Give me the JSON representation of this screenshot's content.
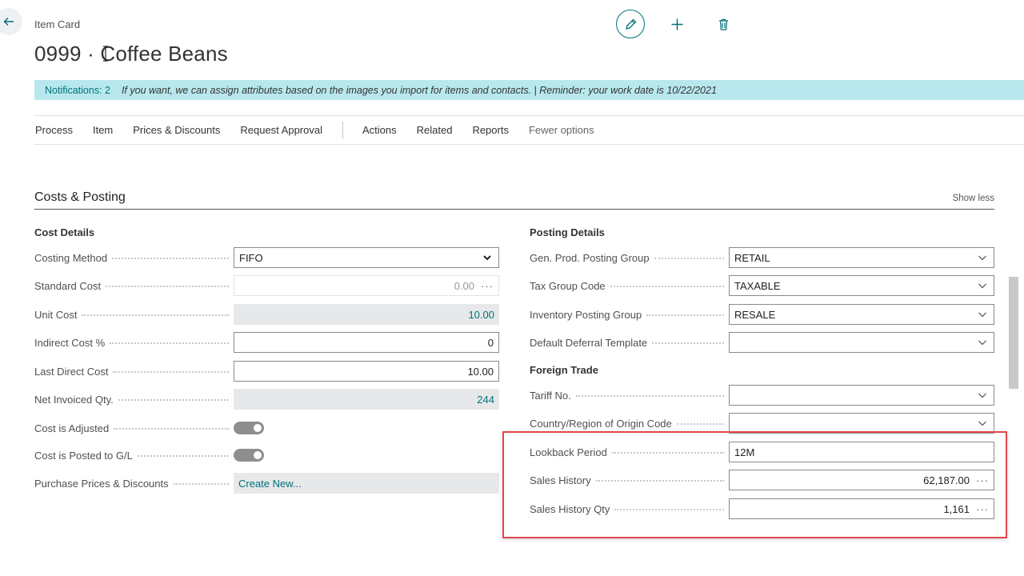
{
  "header": {
    "caption": "Item Card",
    "title": "0999 · Coffee Beans"
  },
  "notification": {
    "count_label": "Notifications: 2",
    "text": "If you want, we can assign attributes based on the images you import for items and contacts. |  Reminder: your work date is 10/22/2021"
  },
  "action_bar": {
    "left": [
      "Process",
      "Item",
      "Prices & Discounts",
      "Request Approval"
    ],
    "right": [
      "Actions",
      "Related",
      "Reports"
    ],
    "fewer_options": "Fewer options"
  },
  "section": {
    "title": "Costs & Posting",
    "show_less": "Show less"
  },
  "cost_details": {
    "title": "Cost Details",
    "costing_method": {
      "label": "Costing Method",
      "value": "FIFO"
    },
    "standard_cost": {
      "label": "Standard Cost",
      "value": "0.00"
    },
    "unit_cost": {
      "label": "Unit Cost",
      "value": "10.00"
    },
    "indirect_cost": {
      "label": "Indirect Cost %",
      "value": "0"
    },
    "last_direct_cost": {
      "label": "Last Direct Cost",
      "value": "10.00"
    },
    "net_invoiced_qty": {
      "label": "Net Invoiced Qty.",
      "value": "244"
    },
    "cost_is_adjusted": {
      "label": "Cost is Adjusted",
      "value": true
    },
    "cost_posted_gl": {
      "label": "Cost is Posted to G/L",
      "value": true
    },
    "purchase_prices": {
      "label": "Purchase Prices & Discounts",
      "value": "Create New..."
    }
  },
  "posting_details": {
    "title": "Posting Details",
    "gen_prod": {
      "label": "Gen. Prod. Posting Group",
      "value": "RETAIL"
    },
    "tax_group": {
      "label": "Tax Group Code",
      "value": "TAXABLE"
    },
    "inventory_group": {
      "label": "Inventory Posting Group",
      "value": "RESALE"
    },
    "deferral": {
      "label": "Default Deferral Template",
      "value": ""
    }
  },
  "foreign_trade": {
    "title": "Foreign Trade",
    "tariff": {
      "label": "Tariff No.",
      "value": ""
    },
    "origin": {
      "label": "Country/Region of Origin Code",
      "value": ""
    },
    "lookback": {
      "label": "Lookback Period",
      "value": "12M"
    },
    "sales_history": {
      "label": "Sales History",
      "value": "62,187.00"
    },
    "sales_history_qty": {
      "label": "Sales History Qty",
      "value": "1,161"
    }
  },
  "colors": {
    "accent": "#00717a",
    "notification_bg": "#b8e8ee",
    "highlight": "#e0474c"
  },
  "icons": {
    "back": "arrow-left-icon",
    "edit": "pencil-icon",
    "new": "plus-icon",
    "delete": "trash-icon",
    "dropdown": "chevron-down-icon",
    "lookup": "ellipsis-icon"
  }
}
